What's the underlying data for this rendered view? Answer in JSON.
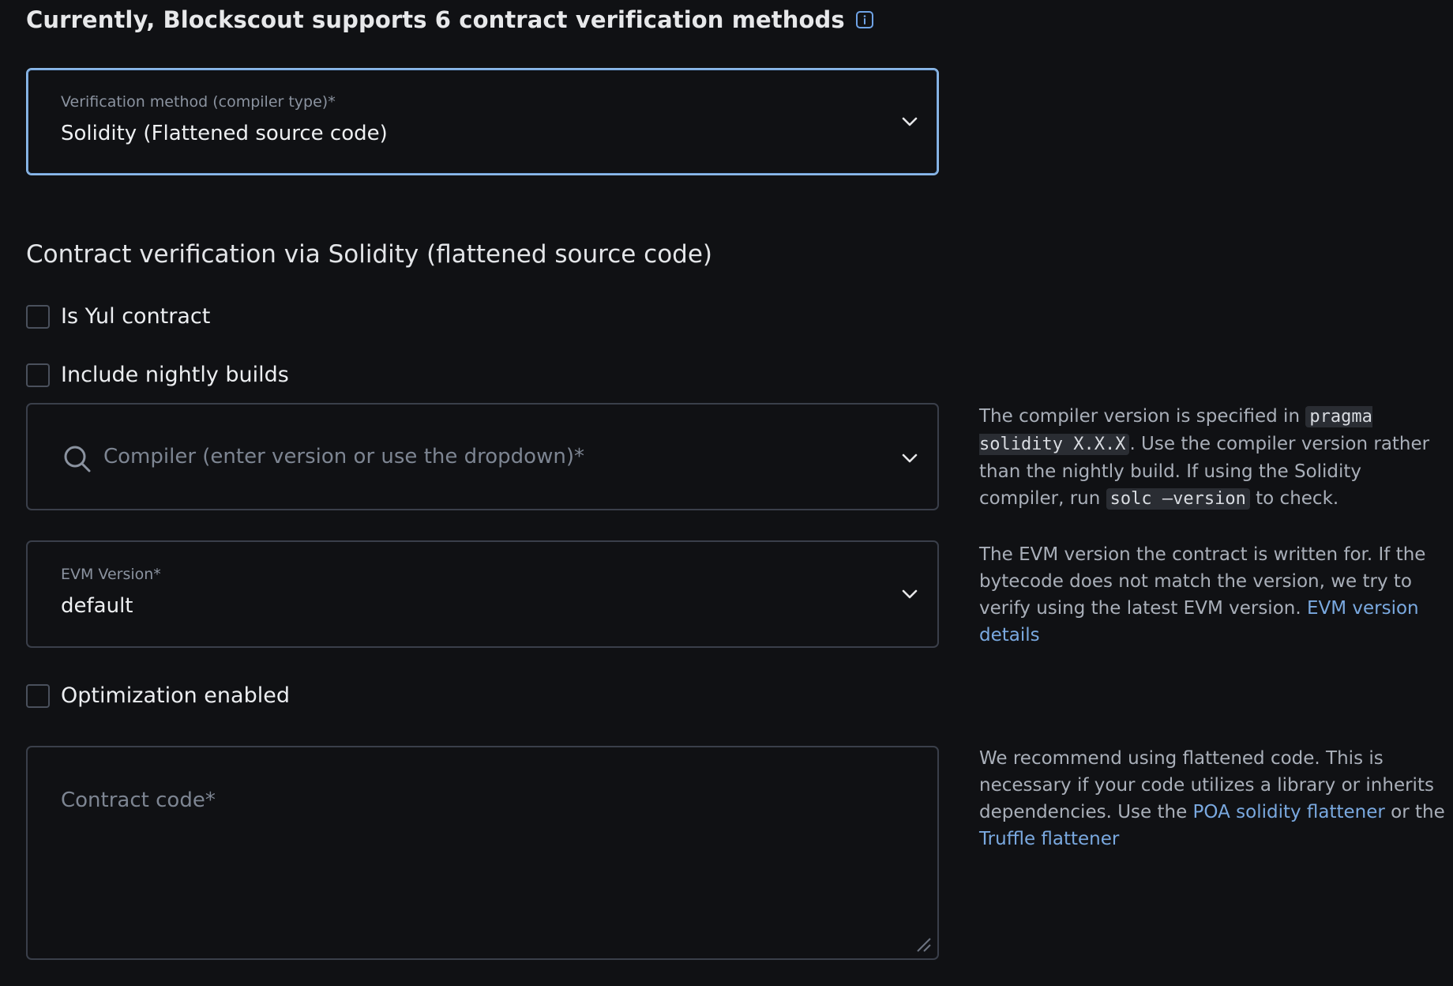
{
  "header": {
    "title": "Currently, Blockscout supports 6 contract verification methods",
    "info_icon": "info-icon"
  },
  "method_select": {
    "label": "Verification method (compiler type)*",
    "value": "Solidity (Flattened source code)",
    "icon": "chevron-down-icon"
  },
  "section": {
    "title": "Contract verification via Solidity (flattened source code)"
  },
  "checkboxes": {
    "yul": {
      "label": "Is Yul contract",
      "checked": false
    },
    "nightly": {
      "label": "Include nightly builds",
      "checked": false
    },
    "optimization": {
      "label": "Optimization enabled",
      "checked": false
    }
  },
  "compiler_select": {
    "placeholder": "Compiler (enter version or use the dropdown)*",
    "icon": "search-icon"
  },
  "evm_select": {
    "label": "EVM Version*",
    "value": "default"
  },
  "contract_code": {
    "placeholder": "Contract code*"
  },
  "help": {
    "compiler": {
      "text1": "The compiler version is specified in ",
      "code1": "pragma solidity X.X.X",
      "text2": ". Use the compiler version rather than the nightly build. If using the Solidity compiler, run ",
      "code2": "solc —version",
      "text3": " to check."
    },
    "evm": {
      "text1": "The EVM version the contract is written for. If the bytecode does not match the version, we try to verify using the latest EVM version. ",
      "link": "EVM version details"
    },
    "code": {
      "text1": "We recommend using flattened code. This is necessary if your code utilizes a library or inherits dependencies. Use the ",
      "link1": "POA solidity flattener",
      "text2": " or the ",
      "link2": "Truffle flattener"
    }
  },
  "colors": {
    "background": "#101114",
    "focus_border": "#8db9e8",
    "link": "#7aa9e0",
    "border": "#3a3f4a"
  }
}
